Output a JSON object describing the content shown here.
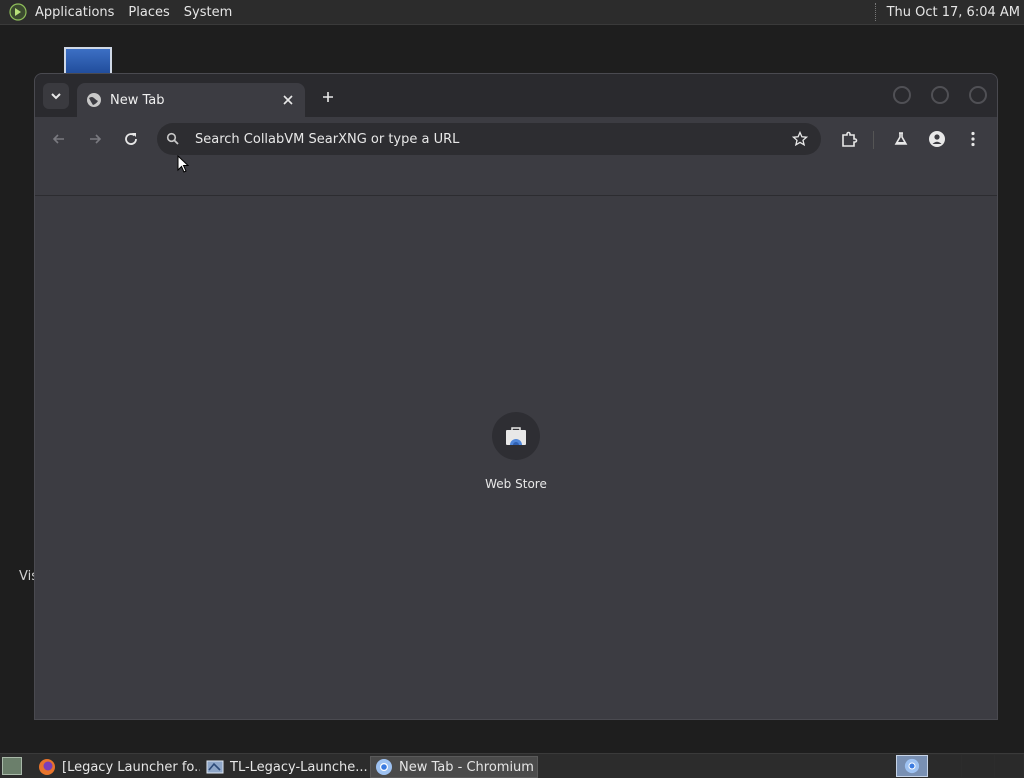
{
  "top_panel": {
    "menus": [
      "Applications",
      "Places",
      "System"
    ],
    "clock": "Thu Oct 17,  6:04 AM"
  },
  "desktop": {
    "partial_label": "Vis"
  },
  "browser": {
    "tab_title": "New Tab",
    "omnibox_placeholder": "Search CollabVM SearXNG or type a URL",
    "shortcut_label": "Web Store"
  },
  "taskbar": {
    "tasks": [
      "[Legacy Launcher fo...",
      "TL-Legacy-Launche...",
      "New Tab - Chromium"
    ]
  },
  "colors": {
    "browser_bg": "#3c3c42",
    "tabstrip_bg": "#2a2a2e",
    "omnibox_bg": "#2d2d31",
    "panel_bg": "#2c2c2c"
  }
}
